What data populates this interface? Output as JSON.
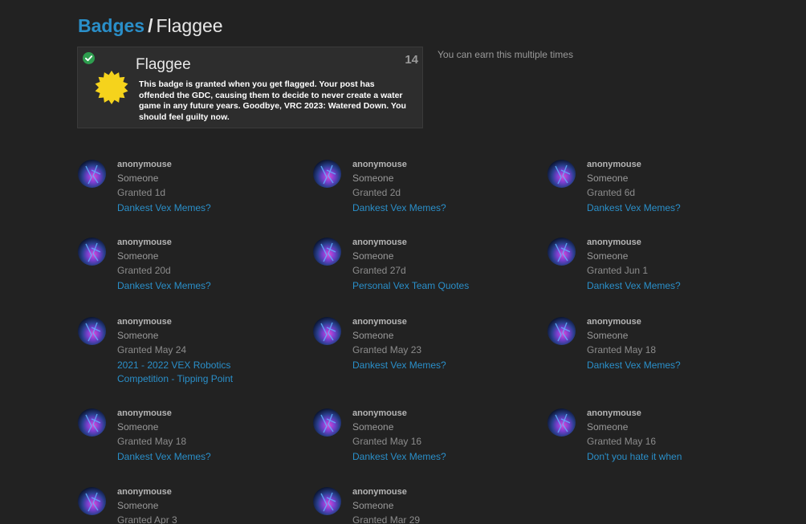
{
  "breadcrumb": {
    "parent": "Badges",
    "separator": "/",
    "current": "Flaggee"
  },
  "badge": {
    "name": "Flaggee",
    "count": "14",
    "description": "This badge is granted when you get flagged. Your post has offended the GDC, causing them to decide to never create a water game in any future years. Goodbye, VRC 2023: Watered Down. You should feel guilty now.",
    "multiple_note": "You can earn this multiple times",
    "check_color": "#2e9e4f",
    "icon_color": "#f5d31c"
  },
  "grants": [
    {
      "user": "anonymouse",
      "role": "Someone",
      "granted": "Granted 1d",
      "topic": "Dankest Vex Memes?"
    },
    {
      "user": "anonymouse",
      "role": "Someone",
      "granted": "Granted 2d",
      "topic": "Dankest Vex Memes?"
    },
    {
      "user": "anonymouse",
      "role": "Someone",
      "granted": "Granted 6d",
      "topic": "Dankest Vex Memes?"
    },
    {
      "user": "anonymouse",
      "role": "Someone",
      "granted": "Granted 20d",
      "topic": "Dankest Vex Memes?"
    },
    {
      "user": "anonymouse",
      "role": "Someone",
      "granted": "Granted 27d",
      "topic": "Personal Vex Team Quotes"
    },
    {
      "user": "anonymouse",
      "role": "Someone",
      "granted": "Granted Jun 1",
      "topic": "Dankest Vex Memes?"
    },
    {
      "user": "anonymouse",
      "role": "Someone",
      "granted": "Granted May 24",
      "topic": "2021 - 2022 VEX Robotics Competition - Tipping Point"
    },
    {
      "user": "anonymouse",
      "role": "Someone",
      "granted": "Granted May 23",
      "topic": "Dankest Vex Memes?"
    },
    {
      "user": "anonymouse",
      "role": "Someone",
      "granted": "Granted May 18",
      "topic": "Dankest Vex Memes?"
    },
    {
      "user": "anonymouse",
      "role": "Someone",
      "granted": "Granted May 18",
      "topic": "Dankest Vex Memes?"
    },
    {
      "user": "anonymouse",
      "role": "Someone",
      "granted": "Granted May 16",
      "topic": "Dankest Vex Memes?"
    },
    {
      "user": "anonymouse",
      "role": "Someone",
      "granted": "Granted May 16",
      "topic": "Don't you hate it when"
    },
    {
      "user": "anonymouse",
      "role": "Someone",
      "granted": "Granted Apr 3",
      "topic": ""
    },
    {
      "user": "anonymouse",
      "role": "Someone",
      "granted": "Granted Mar 29",
      "topic": ""
    }
  ]
}
